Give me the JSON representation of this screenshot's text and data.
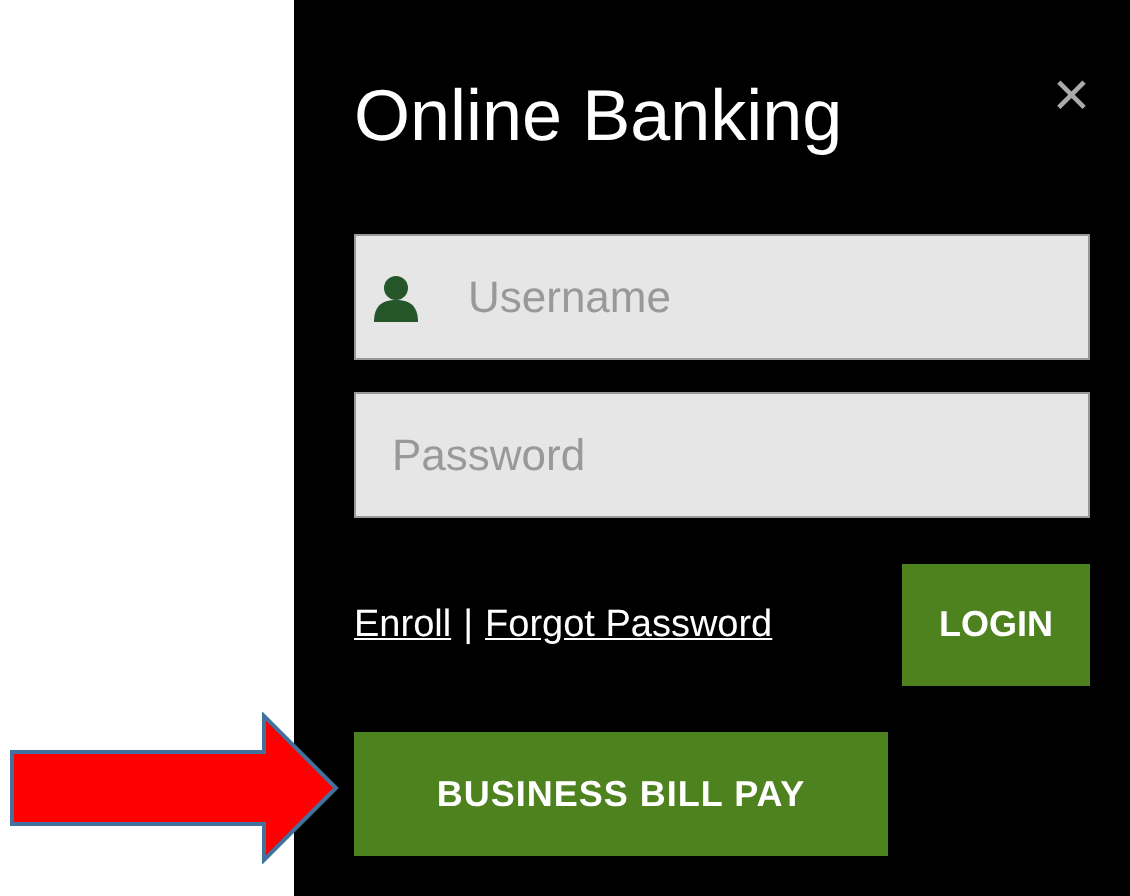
{
  "panel": {
    "title": "Online Banking",
    "close": "×"
  },
  "fields": [
    {
      "kind": "username",
      "placeholder": "Username"
    },
    {
      "kind": "password",
      "placeholder": "Password"
    }
  ],
  "links": [
    "Enroll",
    "Forgot Password"
  ],
  "separator": "|",
  "login_button": "LOGIN",
  "bill_pay_button": "BUSINESS BILL PAY"
}
